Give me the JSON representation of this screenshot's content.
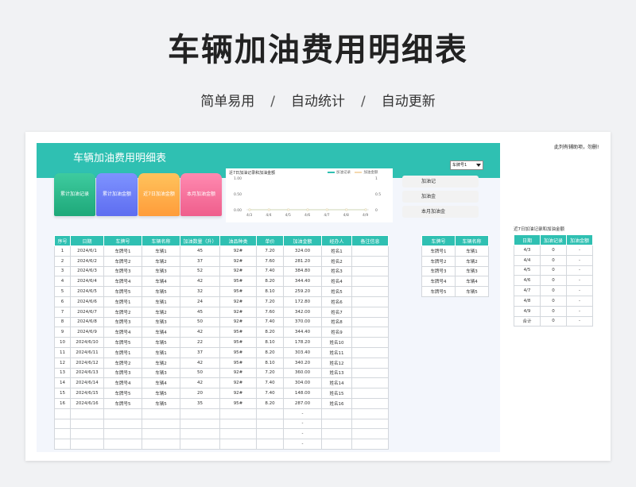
{
  "hero": {
    "title": "车辆加油费用明细表",
    "tags": [
      "简单易用",
      "自动统计",
      "自动更新"
    ],
    "separator": "/"
  },
  "sheet": {
    "title": "车辆加油费用明细表",
    "vehicle_select": {
      "value": "车牌号1"
    },
    "note": "此列有辅助项，勿删!",
    "cards": [
      "累计加油记录",
      "累计加油金额",
      "近7日加油金额",
      "本月加油金额"
    ],
    "summary_buttons": [
      "加油记",
      "加油金",
      "本月加油金"
    ],
    "chart": {
      "title": "近7日加油记录和加油金额",
      "legend": [
        "加油记录",
        "加油金额"
      ]
    },
    "main_table": {
      "headers": [
        "序号",
        "日期",
        "车牌号",
        "车辆名称",
        "加油数量（升）",
        "油品种类",
        "单价",
        "加油金额",
        "经办人",
        "备注信息"
      ],
      "rows": [
        [
          "1",
          "2024/6/1",
          "车牌号1",
          "车辆1",
          "45",
          "92#",
          "7.20",
          "324.00",
          "姓名1",
          ""
        ],
        [
          "2",
          "2024/6/2",
          "车牌号2",
          "车辆2",
          "37",
          "92#",
          "7.60",
          "281.20",
          "姓名2",
          ""
        ],
        [
          "3",
          "2024/6/3",
          "车牌号3",
          "车辆3",
          "52",
          "92#",
          "7.40",
          "384.80",
          "姓名3",
          ""
        ],
        [
          "4",
          "2024/6/4",
          "车牌号4",
          "车辆4",
          "42",
          "95#",
          "8.20",
          "344.40",
          "姓名4",
          ""
        ],
        [
          "5",
          "2024/6/5",
          "车牌号5",
          "车辆5",
          "32",
          "95#",
          "8.10",
          "259.20",
          "姓名5",
          ""
        ],
        [
          "6",
          "2024/6/6",
          "车牌号1",
          "车辆1",
          "24",
          "92#",
          "7.20",
          "172.80",
          "姓名6",
          ""
        ],
        [
          "7",
          "2024/6/7",
          "车牌号2",
          "车辆2",
          "45",
          "92#",
          "7.60",
          "342.00",
          "姓名7",
          ""
        ],
        [
          "8",
          "2024/6/8",
          "车牌号3",
          "车辆3",
          "50",
          "92#",
          "7.40",
          "370.00",
          "姓名8",
          ""
        ],
        [
          "9",
          "2024/6/9",
          "车牌号4",
          "车辆4",
          "42",
          "95#",
          "8.20",
          "344.40",
          "姓名9",
          ""
        ],
        [
          "10",
          "2024/6/10",
          "车牌号5",
          "车辆5",
          "22",
          "95#",
          "8.10",
          "178.20",
          "姓名10",
          ""
        ],
        [
          "11",
          "2024/6/11",
          "车牌号1",
          "车辆1",
          "37",
          "95#",
          "8.20",
          "303.40",
          "姓名11",
          ""
        ],
        [
          "12",
          "2024/6/12",
          "车牌号2",
          "车辆2",
          "42",
          "95#",
          "8.10",
          "340.20",
          "姓名12",
          ""
        ],
        [
          "13",
          "2024/6/13",
          "车牌号3",
          "车辆3",
          "50",
          "92#",
          "7.20",
          "360.00",
          "姓名13",
          ""
        ],
        [
          "14",
          "2024/6/14",
          "车牌号4",
          "车辆4",
          "42",
          "92#",
          "7.40",
          "304.00",
          "姓名14",
          ""
        ],
        [
          "15",
          "2024/6/15",
          "车牌号5",
          "车辆5",
          "20",
          "92#",
          "7.40",
          "148.00",
          "姓名15",
          ""
        ],
        [
          "16",
          "2024/6/16",
          "车牌号5",
          "车辆5",
          "35",
          "95#",
          "8.20",
          "287.00",
          "姓名16",
          ""
        ],
        [
          "",
          "",
          "",
          "",
          "",
          "",
          "",
          "-",
          "",
          ""
        ],
        [
          "",
          "",
          "",
          "",
          "",
          "",
          "",
          "-",
          "",
          ""
        ],
        [
          "",
          "",
          "",
          "",
          "",
          "",
          "",
          "-",
          "",
          ""
        ],
        [
          "",
          "",
          "",
          "",
          "",
          "",
          "",
          "-",
          "",
          ""
        ]
      ]
    },
    "vehicle_table": {
      "headers": [
        "车牌号",
        "车辆名称"
      ],
      "rows": [
        [
          "车牌号1",
          "车辆1"
        ],
        [
          "车牌号2",
          "车辆2"
        ],
        [
          "车牌号3",
          "车辆3"
        ],
        [
          "车牌号4",
          "车辆4"
        ],
        [
          "车牌号5",
          "车辆5"
        ]
      ]
    },
    "recent7": {
      "title": "近7日加油记录和加油金额",
      "headers": [
        "日期",
        "加油记录",
        "加油金额"
      ],
      "rows": [
        [
          "4/3",
          "0",
          "-"
        ],
        [
          "4/4",
          "0",
          "-"
        ],
        [
          "4/5",
          "0",
          "-"
        ],
        [
          "4/6",
          "0",
          "-"
        ],
        [
          "4/7",
          "0",
          "-"
        ],
        [
          "4/8",
          "0",
          "-"
        ],
        [
          "4/9",
          "0",
          "-"
        ],
        [
          "合计",
          "0",
          "-"
        ]
      ]
    }
  },
  "chart_data": {
    "type": "line",
    "title": "近7日加油记录和加油金额",
    "categories": [
      "4/3",
      "4/4",
      "4/5",
      "4/6",
      "4/7",
      "4/8",
      "4/9"
    ],
    "series": [
      {
        "name": "加油记录",
        "values": [
          0,
          0,
          0,
          0,
          0,
          0,
          0
        ],
        "color": "#2fc0b2"
      },
      {
        "name": "加油金额",
        "values": [
          0,
          0,
          0,
          0,
          0,
          0,
          0
        ],
        "color": "#f5d9b0"
      }
    ],
    "y_left": {
      "ticks": [
        "1.00",
        "0.50",
        "0.00"
      ],
      "range": [
        0,
        1
      ]
    },
    "y_right": {
      "ticks": [
        "1",
        "0.5",
        "0"
      ],
      "range": [
        0,
        1
      ]
    },
    "legend_position": "top-right",
    "grid": false
  }
}
